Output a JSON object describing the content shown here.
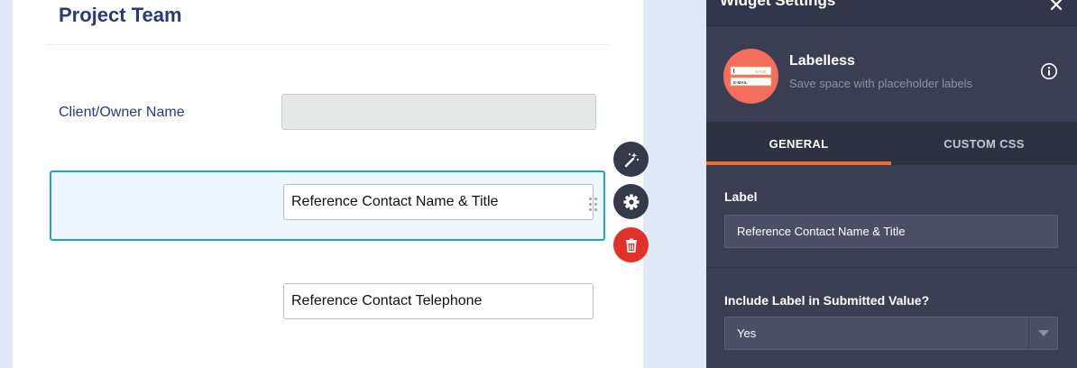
{
  "form": {
    "title": "Project Team",
    "client_label": "Client/Owner Name",
    "client_value": "",
    "ref_name_value": "Reference Contact Name & Title",
    "ref_tel_value": "Reference Contact Telephone"
  },
  "field_actions": [
    {
      "icon": "magic-wand-icon",
      "color": "#343a4a"
    },
    {
      "icon": "gear-icon",
      "color": "#343a4a"
    },
    {
      "icon": "trash-icon",
      "color": "#e0322b"
    }
  ],
  "panel": {
    "title": "Widget Settings",
    "close_icon": "close-icon",
    "widget_name": "Labelless",
    "widget_desc": "Save space with placeholder labels",
    "logo_text": {
      "name": "NAME",
      "email": "E-MAIL"
    },
    "tabs": [
      {
        "label": "GENERAL",
        "active": true
      },
      {
        "label": "CUSTOM CSS",
        "active": false
      }
    ],
    "label_heading": "Label",
    "label_value": "Reference Contact Name & Title",
    "include_heading": "Include Label in Submitted Value?",
    "include_value": "Yes"
  },
  "colors": {
    "accent": "#f06b24",
    "selected_border": "#1ea7c6",
    "title_text": "#2c3a75",
    "panel_bg": "#3a3e52"
  }
}
